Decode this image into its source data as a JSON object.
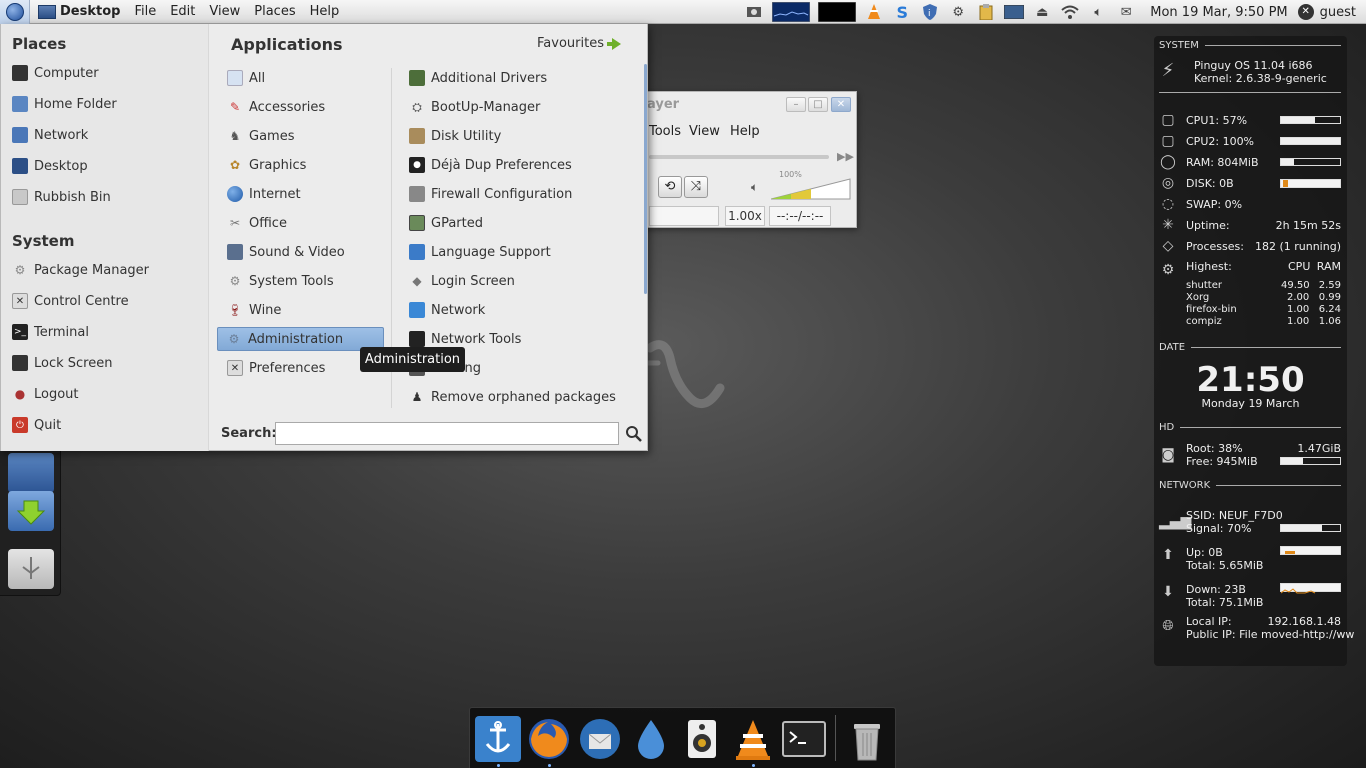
{
  "top_panel": {
    "menu_items": [
      "Desktop",
      "File",
      "Edit",
      "View",
      "Places",
      "Help"
    ],
    "clock": "Mon 19 Mar,  9:50 PM",
    "user": "guest"
  },
  "menu": {
    "places_title": "Places",
    "places": [
      "Computer",
      "Home Folder",
      "Network",
      "Desktop",
      "Rubbish Bin"
    ],
    "system_title": "System",
    "system": [
      "Package Manager",
      "Control Centre",
      "Terminal",
      "Lock Screen",
      "Logout",
      "Quit"
    ],
    "applications_title": "Applications",
    "favourites_label": "Favourites",
    "categories": [
      "All",
      "Accessories",
      "Games",
      "Graphics",
      "Internet",
      "Office",
      "Sound & Video",
      "System Tools",
      "Wine",
      "Administration",
      "Preferences"
    ],
    "selected_category": "Administration",
    "apps": [
      "Additional Drivers",
      "BootUp-Manager",
      "Disk Utility",
      "Déjà Dup Preferences",
      "Firewall Configuration",
      "GParted",
      "Language Support",
      "Login Screen",
      "Network",
      "Network Tools",
      "Printing",
      "Remove orphaned packages"
    ],
    "tooltip": "Administration",
    "search_label": "Search:",
    "search_value": ""
  },
  "player": {
    "title": "ayer",
    "menus": [
      "Tools",
      "View",
      "Help"
    ],
    "volume": "100%",
    "speed": "1.00x",
    "time": "--:--/--:--"
  },
  "conky": {
    "system_label": "SYSTEM",
    "os": "Pinguy OS 11.04 i686",
    "kernel": "Kernel: 2.6.38-9-generic",
    "cpu1": "CPU1: 57%",
    "cpu1_pct": 57,
    "cpu2": "CPU2: 100%",
    "cpu2_pct": 100,
    "ram": "RAM: 804MiB",
    "ram_pct": 22,
    "disk": "DISK: 0B",
    "swap": "SWAP: 0%",
    "uptime_label": "Uptime:",
    "uptime": "2h 15m 52s",
    "processes_label": "Processes:",
    "processes": "182 (1 running)",
    "highest_label": "Highest:",
    "cpu_col": "CPU",
    "ram_col": "RAM",
    "top": [
      {
        "name": "shutter",
        "cpu": "49.50",
        "ram": "2.59"
      },
      {
        "name": "Xorg",
        "cpu": "2.00",
        "ram": "0.99"
      },
      {
        "name": "firefox-bin",
        "cpu": "1.00",
        "ram": "6.24"
      },
      {
        "name": "compiz",
        "cpu": "1.00",
        "ram": "1.06"
      }
    ],
    "date_label": "DATE",
    "time": "21:50",
    "date": "Monday 19 March",
    "hd_label": "HD",
    "root": "Root: 38%",
    "root_size": "1.47GiB",
    "free": "Free: 945MiB",
    "free_pct": 38,
    "network_label": "NETWORK",
    "ssid": "SSID: NEUF_F7D0",
    "signal": "Signal: 70%",
    "signal_pct": 70,
    "up": "Up: 0B",
    "up_total": "Total: 5.65MiB",
    "down": "Down: 23B",
    "down_total": "Total: 75.1MiB",
    "local_ip_label": "Local IP:",
    "local_ip": "192.168.1.48",
    "public_ip": "Public IP: File moved-http://ww"
  },
  "colors": {
    "panel_bg": "#e4e4e4",
    "menu_bg": "#ececec",
    "selection": "#8fb3dd",
    "conky_bg": "#161616",
    "favourites_arrow": "#6fb02a"
  },
  "icons": {
    "dock": [
      "anchor-icon",
      "firefox-icon",
      "thunderbird-icon",
      "drop-icon",
      "speaker-icon",
      "vlc-icon",
      "terminal-icon",
      "trash-icon"
    ]
  }
}
